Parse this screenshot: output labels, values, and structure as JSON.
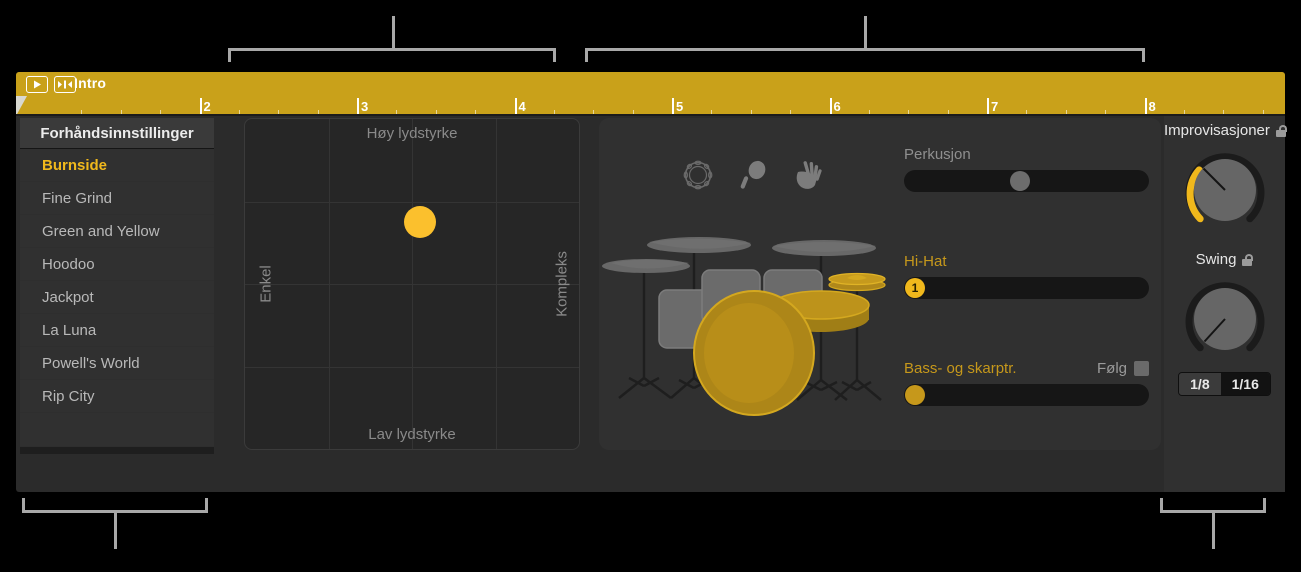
{
  "ruler": {
    "section_name": "Intro",
    "play_icon": "play-icon",
    "cycle_icon": "cycle-icon",
    "bars": [
      "2",
      "3",
      "4",
      "5",
      "6",
      "7",
      "8"
    ],
    "accent_color": "#c9a11a"
  },
  "presets": {
    "header": "Forhåndsinnstillinger",
    "selected": "Burnside",
    "items": [
      "Burnside",
      "Fine Grind",
      "Green and Yellow",
      "Hoodoo",
      "Jackpot",
      "La Luna",
      "Powell's World",
      "Rip City"
    ]
  },
  "xy_pad": {
    "top_label": "Høy lydstyrke",
    "bottom_label": "Lav lydstyrke",
    "left_label": "Enkel",
    "right_label": "Kompleks",
    "puck_x_pct": 52,
    "puck_y_pct": 31,
    "puck_color": "#fbc02d"
  },
  "center": {
    "percussion_icons": [
      "tambourine-icon",
      "maraca-icon",
      "clap-icon"
    ],
    "sliders": [
      {
        "label": "Perkusjon",
        "value_pct": 47,
        "knob_style": "grey",
        "knob_text": ""
      },
      {
        "label": "Hi-Hat",
        "value_pct": 0,
        "knob_style": "bright",
        "knob_text": "1"
      },
      {
        "label": "Bass- og skarptr.",
        "value_pct": 0,
        "knob_style": "gold",
        "knob_text": ""
      }
    ],
    "follow": {
      "label": "Følg",
      "checked": false
    }
  },
  "right_panel": {
    "knob1": {
      "label": "Improvisasjoner",
      "locked": false,
      "value_pct": 15,
      "arc_color": "#f0b81c"
    },
    "knob2": {
      "label": "Swing",
      "locked": false,
      "value_pct": 0
    },
    "swing_grid": {
      "options": [
        "1/8",
        "1/16"
      ],
      "selected": "1/16"
    }
  }
}
